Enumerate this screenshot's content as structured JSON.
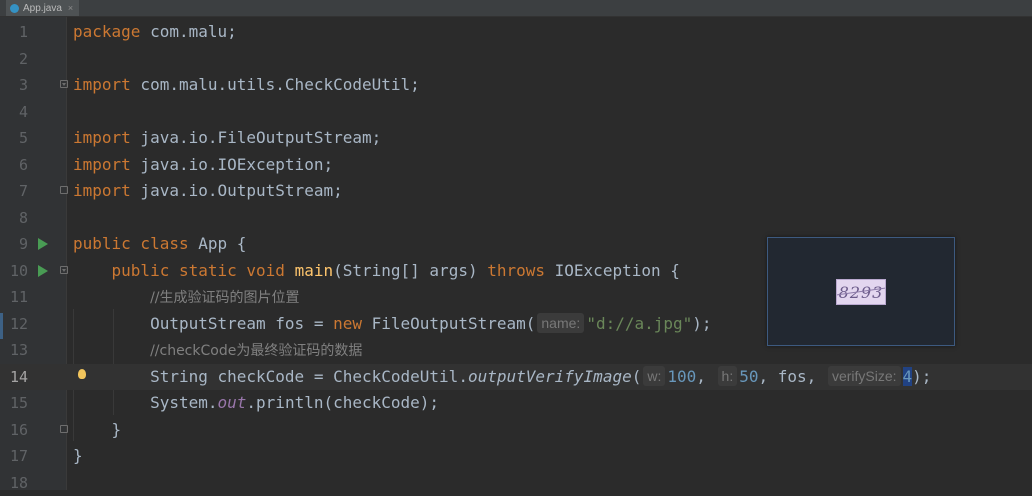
{
  "tab": {
    "filename": "App.java",
    "icon": "java-class-icon",
    "close": "×"
  },
  "popup": {
    "captcha_text": "8293"
  },
  "lines": [
    {
      "n": "1"
    },
    {
      "n": "2"
    },
    {
      "n": "3"
    },
    {
      "n": "4"
    },
    {
      "n": "5"
    },
    {
      "n": "6"
    },
    {
      "n": "7"
    },
    {
      "n": "8"
    },
    {
      "n": "9"
    },
    {
      "n": "10"
    },
    {
      "n": "11"
    },
    {
      "n": "12"
    },
    {
      "n": "13"
    },
    {
      "n": "14"
    },
    {
      "n": "15"
    },
    {
      "n": "16"
    },
    {
      "n": "17"
    },
    {
      "n": "18"
    }
  ],
  "code": {
    "l1_kw": "package",
    "l1_rest": " com.malu;",
    "l3_kw": "import",
    "l3_rest": " com.malu.utils.CheckCodeUtil;",
    "l5_kw": "import",
    "l5_rest": " java.io.FileOutputStream;",
    "l6_kw": "import",
    "l6_rest": " java.io.IOException;",
    "l7_kw": "import",
    "l7_rest": " java.io.OutputStream;",
    "l9_kw": "public class",
    "l9_rest": " App {",
    "l10_kw1": "public static void",
    "l10_fn": "main",
    "l10_mid": "(String[] args) ",
    "l10_kw2": "throws",
    "l10_rest": " IOException {",
    "l11_cmt": "//生成验证码的图片位置",
    "l12_a": "OutputStream fos = ",
    "l12_kw": "new",
    "l12_b": " FileOutputStream(",
    "l12_hint": "name:",
    "l12_str": "\"d://a.jpg\"",
    "l12_c": ");",
    "l13_cmt": "//checkCode为最终验证码的数据",
    "l14_a": "String checkCode = CheckCodeUtil.",
    "l14_fn": "outputVerifyImage",
    "l14_b": "(",
    "l14_hint1": "w:",
    "l14_n1": "100",
    "l14_c1": ",",
    "l14_hint2": "h:",
    "l14_n2": "50",
    "l14_c2": ", fos,",
    "l14_hint3": "verifySize:",
    "l14_n3": "4",
    "l14_d": ");",
    "l15_a": "System.",
    "l15_static": "out",
    "l15_b": ".println(checkCode);",
    "l16": "}",
    "l17": "}"
  }
}
